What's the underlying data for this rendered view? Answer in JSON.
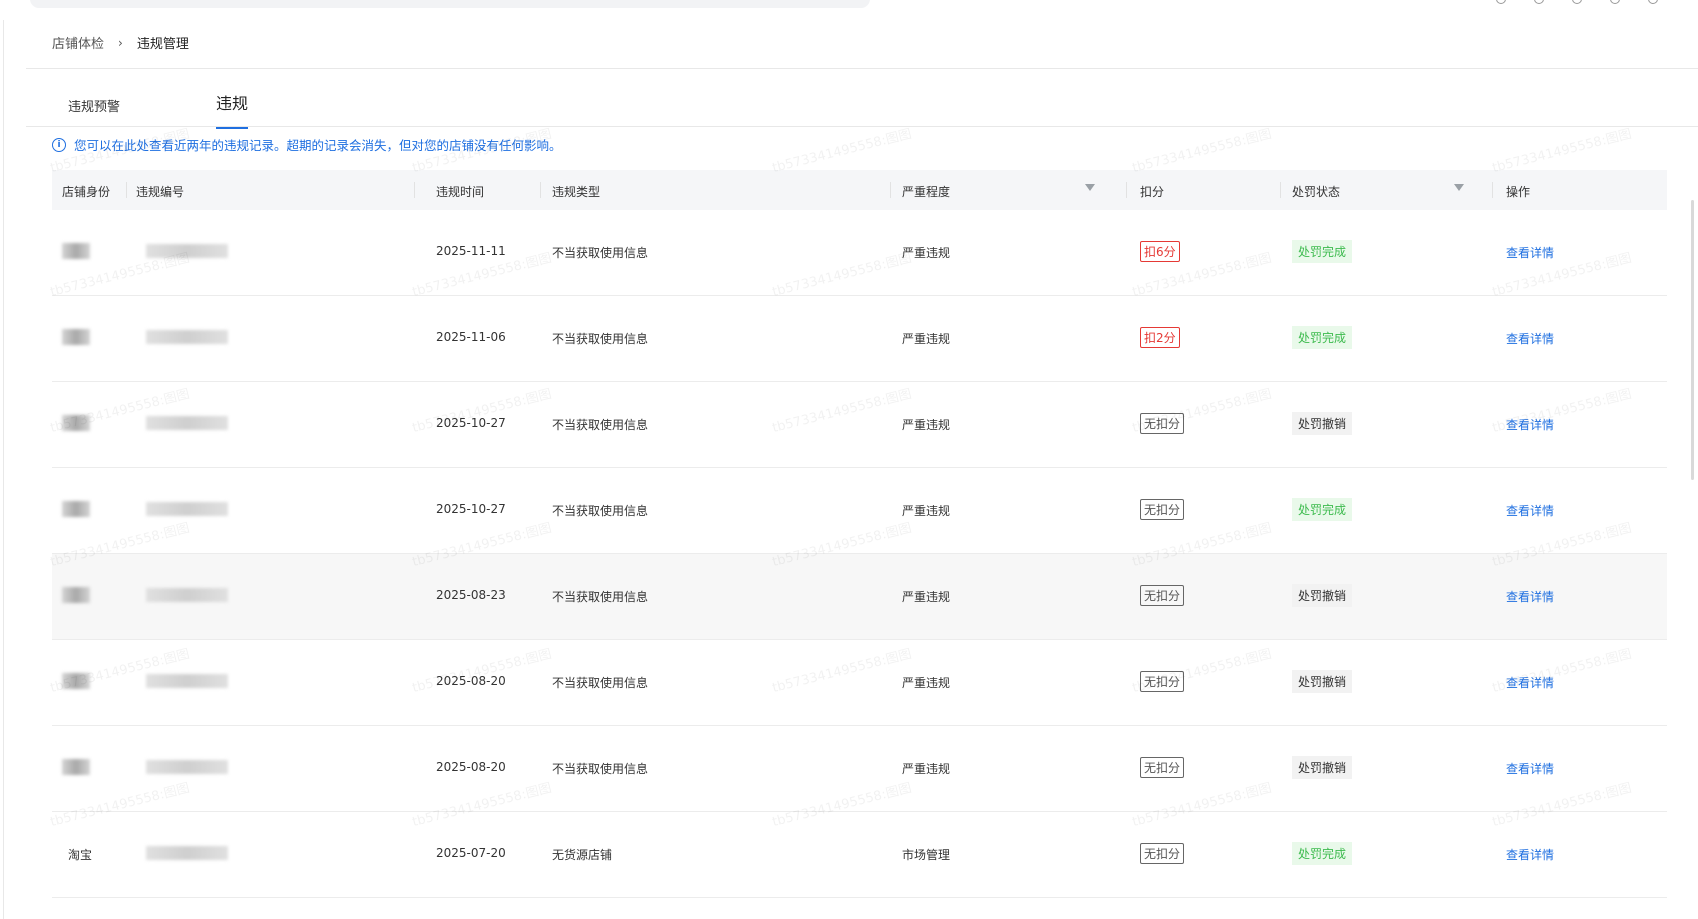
{
  "breadcrumb": {
    "parent": "店铺体检",
    "separator": "›",
    "current": "违规管理"
  },
  "tabs": [
    {
      "label": "违规预警",
      "active": false
    },
    {
      "label": "违规",
      "active": true
    }
  ],
  "notice": {
    "icon": "info-icon",
    "text": "您可以在此处查看近两年的违规记录。超期的记录会消失，但对您的店铺没有任何影响。"
  },
  "table": {
    "headers": {
      "shop_identity": "店铺身份",
      "violation_no": "违规编号",
      "time": "违规时间",
      "type": "违规类型",
      "severity": "严重程度",
      "points": "扣分",
      "status": "处罚状态",
      "action": "操作"
    },
    "rows": [
      {
        "identity": "",
        "date": "2025-11-11",
        "type": "不当获取使用信息",
        "severity": "严重违规",
        "points": "扣6分",
        "points_style": "red",
        "status": "处罚完成",
        "status_style": "done",
        "action": "查看详情"
      },
      {
        "identity": "",
        "date": "2025-11-06",
        "type": "不当获取使用信息",
        "severity": "严重违规",
        "points": "扣2分",
        "points_style": "red",
        "status": "处罚完成",
        "status_style": "done",
        "action": "查看详情"
      },
      {
        "identity": "",
        "date": "2025-10-27",
        "type": "不当获取使用信息",
        "severity": "严重违规",
        "points": "无扣分",
        "points_style": "gray",
        "status": "处罚撤销",
        "status_style": "cancel",
        "action": "查看详情"
      },
      {
        "identity": "",
        "date": "2025-10-27",
        "type": "不当获取使用信息",
        "severity": "严重违规",
        "points": "无扣分",
        "points_style": "gray",
        "status": "处罚完成",
        "status_style": "done",
        "action": "查看详情"
      },
      {
        "identity": "",
        "date": "2025-08-23",
        "type": "不当获取使用信息",
        "severity": "严重违规",
        "points": "无扣分",
        "points_style": "gray",
        "status": "处罚撤销",
        "status_style": "cancel",
        "action": "查看详情"
      },
      {
        "identity": "",
        "date": "2025-08-20",
        "type": "不当获取使用信息",
        "severity": "严重违规",
        "points": "无扣分",
        "points_style": "gray",
        "status": "处罚撤销",
        "status_style": "cancel",
        "action": "查看详情"
      },
      {
        "identity": "",
        "date": "2025-08-20",
        "type": "不当获取使用信息",
        "severity": "严重违规",
        "points": "无扣分",
        "points_style": "gray",
        "status": "处罚撤销",
        "status_style": "cancel",
        "action": "查看详情"
      },
      {
        "identity": "淘宝",
        "date": "2025-07-20",
        "type": "无货源店铺",
        "severity": "市场管理",
        "points": "无扣分",
        "points_style": "gray",
        "status": "处罚完成",
        "status_style": "done",
        "action": "查看详情"
      }
    ]
  },
  "watermark": {
    "text": "tb573341495558:图图"
  },
  "colors": {
    "accent": "#1f6fe0",
    "danger": "#e53935",
    "success": "#3dbb4e",
    "success_bg": "#e9f9ea"
  }
}
